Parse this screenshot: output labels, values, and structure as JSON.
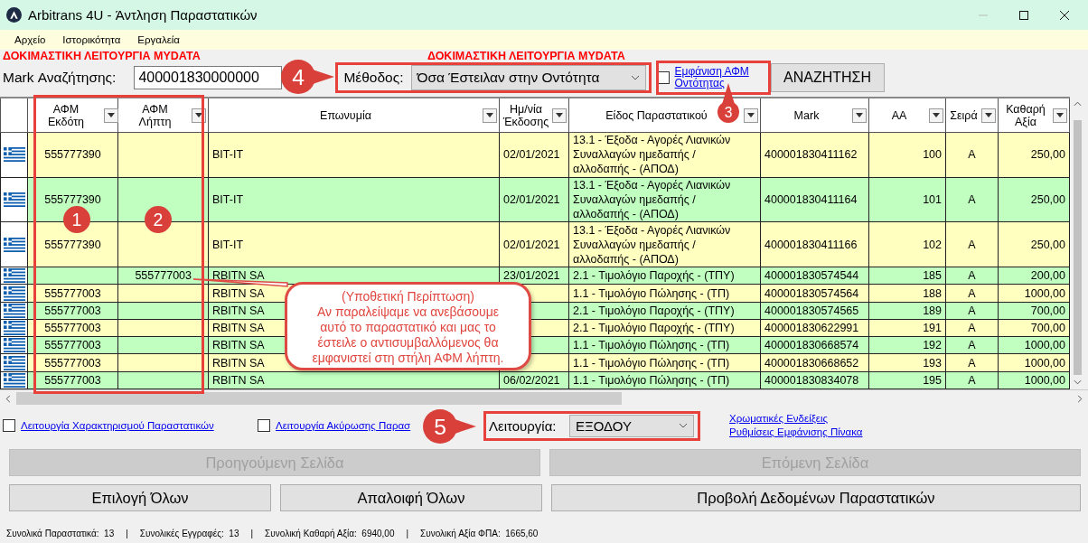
{
  "window": {
    "title": "Arbitrans 4U - Άντληση Παραστατικών"
  },
  "menu": [
    "Αρχείο",
    "Ιστορικότητα",
    "Εργαλεία"
  ],
  "warnings": [
    "ΔΟΚΙΜΑΣΤΙΚΗ ΛΕΙΤΟΥΡΓΙΑ MYDATA",
    "ΔΟΚΙΜΑΣΤΙΚΗ ΛΕΙΤΟΥΡΓΙΑ MYDATA"
  ],
  "search": {
    "label": "Mark Αναζήτησης:",
    "value": "400001830000000"
  },
  "method": {
    "label": "Μέθοδος:",
    "value": "Όσα Έστειλαν στην Οντότητα"
  },
  "show_vat": {
    "label": "Εμφάνιση ΑΦΜ Οντότητας",
    "checked": false
  },
  "search_button": "ΑΝΑΖΗΤΗΣΗ",
  "table": {
    "columns": [
      "ΑΦΜ Εκδότη",
      "ΑΦΜ Λήπτη",
      "Επωνυμία",
      "Ημ/νία Έκδοσης",
      "Είδος Παραστατικού",
      "Mark",
      "ΑΑ",
      "Σειρά",
      "Καθαρή Αξία"
    ],
    "rows": [
      {
        "issuer": "555777390",
        "name": "BIT-IT",
        "date": "02/01/2021",
        "type": "13.1 - Έξοδα - Αγορές Λιανικών Συναλλαγών ημεδαπής / αλλοδαπής - (ΑΠΟΔ)",
        "mark": "400001830411162",
        "aa": "100",
        "series": "Α",
        "net": "250,00"
      },
      {
        "issuer": "555777390",
        "name": "BIT-IT",
        "date": "02/01/2021",
        "type": "13.1 - Έξοδα - Αγορές Λιανικών Συναλλαγών ημεδαπής / αλλοδαπής - (ΑΠΟΔ)",
        "mark": "400001830411164",
        "aa": "101",
        "series": "Α",
        "net": "250,00"
      },
      {
        "issuer": "555777390",
        "name": "BIT-IT",
        "date": "02/01/2021",
        "type": "13.1 - Έξοδα - Αγορές Λιανικών Συναλλαγών ημεδαπής / αλλοδαπής - (ΑΠΟΔ)",
        "mark": "400001830411166",
        "aa": "102",
        "series": "Α",
        "net": "250,00"
      },
      {
        "recipient": "555777003",
        "name": "RBITN SA",
        "date": "23/01/2021",
        "type": "2.1 - Τιμολόγιο Παροχής - (ΤΠΥ)",
        "mark": "400001830574544",
        "aa": "185",
        "series": "Α",
        "net": "200,00"
      },
      {
        "issuer": "555777003",
        "name": "RBITN SA",
        "type": "1.1 - Τιμολόγιο Πώλησης - (ΤΠ)",
        "mark": "400001830574564",
        "aa": "188",
        "series": "Α",
        "net": "1000,00"
      },
      {
        "issuer": "555777003",
        "name": "RBITN SA",
        "type": "2.1 - Τιμολόγιο Παροχής - (ΤΠΥ)",
        "mark": "400001830574565",
        "aa": "189",
        "series": "Α",
        "net": "700,00"
      },
      {
        "issuer": "555777003",
        "name": "RBITN SA",
        "type": "2.1 - Τιμολόγιο Παροχής - (ΤΠΥ)",
        "mark": "400001830622991",
        "aa": "191",
        "series": "Α",
        "net": "700,00"
      },
      {
        "issuer": "555777003",
        "name": "RBITN SA",
        "type": "1.1 - Τιμολόγιο Πώλησης - (ΤΠ)",
        "mark": "400001830668574",
        "aa": "192",
        "series": "Α",
        "net": "1000,00"
      },
      {
        "issuer": "555777003",
        "name": "RBITN SA",
        "type": "1.1 - Τιμολόγιο Πώλησης - (ΤΠ)",
        "mark": "400001830668652",
        "aa": "193",
        "series": "Α",
        "net": "1000,00"
      },
      {
        "issuer": "555777003",
        "name": "RBITN SA",
        "date": "06/02/2021",
        "type": "1.1 - Τιμολόγιο Πώλησης - (ΤΠ)",
        "mark": "400001830834078",
        "aa": "195",
        "series": "Α",
        "net": "1000,00"
      }
    ]
  },
  "options": [
    {
      "label": "Λειτουργία Χαρακτηρισμού Παραστατικών",
      "checked": false
    },
    {
      "label": "Λειτουργία Ακύρωσης Παρασ",
      "checked": false
    }
  ],
  "mode": {
    "label": "Λειτουργία:",
    "value": "ΕΞΟΔΟΥ"
  },
  "links": [
    "Χρωματικές Ενδείξεις",
    "Ρυθμίσεις Εμφάνισης Πίνακα"
  ],
  "page_buttons": [
    {
      "label": "Προηγούμενη Σελίδα",
      "disabled": true
    },
    {
      "label": "Επόμενη Σελίδα",
      "disabled": true
    }
  ],
  "action_buttons": [
    "Επιλογή Όλων",
    "Απαλοιφή Όλων",
    "Προβολή Δεδομένων Παραστατικών"
  ],
  "status_bar": [
    {
      "kind": "field",
      "label": "Συνολικά Παραστατικά:",
      "value": "13"
    },
    {
      "kind": "separator",
      "text": "|"
    },
    {
      "kind": "field",
      "label": "Συνολικές Εγγραφές:",
      "value": "13"
    },
    {
      "kind": "separator",
      "text": "|"
    },
    {
      "kind": "field",
      "label": "Συνολική Καθαρή Αξία:",
      "value": "6940,00"
    },
    {
      "kind": "separator",
      "text": "|"
    },
    {
      "kind": "field",
      "label": "Συνολική Αξία ΦΠΑ:",
      "value": "1665,60"
    }
  ],
  "annotations": [
    {
      "kind": "frame"
    },
    {
      "kind": "badge",
      "label": "1"
    },
    {
      "kind": "badge",
      "label": "2"
    },
    {
      "kind": "frame"
    },
    {
      "kind": "badge",
      "label": "4"
    },
    {
      "kind": "frame"
    },
    {
      "kind": "badge",
      "label": "3"
    },
    {
      "kind": "callout",
      "lines": [
        "(Υποθετική Περίπτωση)",
        "Αν παραλείψαμε να ανεβάσουμε",
        "αυτό το παραστατικό και μας το",
        "έστειλε ο αντισυμβαλλόμενος θα",
        "εμφανιστεί στη στήλη ΑΦΜ λήπτη."
      ]
    },
    {
      "kind": "frame"
    },
    {
      "kind": "badge",
      "label": "5"
    }
  ]
}
